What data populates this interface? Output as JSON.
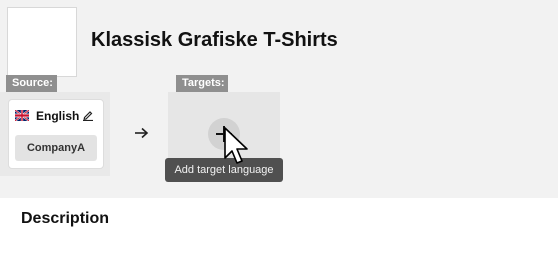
{
  "product": {
    "title": "Klassisk Grafiske T-Shirts"
  },
  "source": {
    "tag": "Source:",
    "language": "English",
    "flag_icon": "uk-flag-icon",
    "edit_icon": "pencil-icon",
    "company": "CompanyA"
  },
  "transfer_icon": "arrow-right-icon",
  "targets": {
    "tag": "Targets:",
    "add_icon": "plus-icon",
    "tooltip": "Add target language"
  },
  "description": {
    "title": "Description"
  },
  "colors": {
    "page_background": "#f2f2f2",
    "tag_background": "#8f8f8f",
    "tooltip_background": "#505050",
    "chip_background": "#e3e3e3"
  }
}
